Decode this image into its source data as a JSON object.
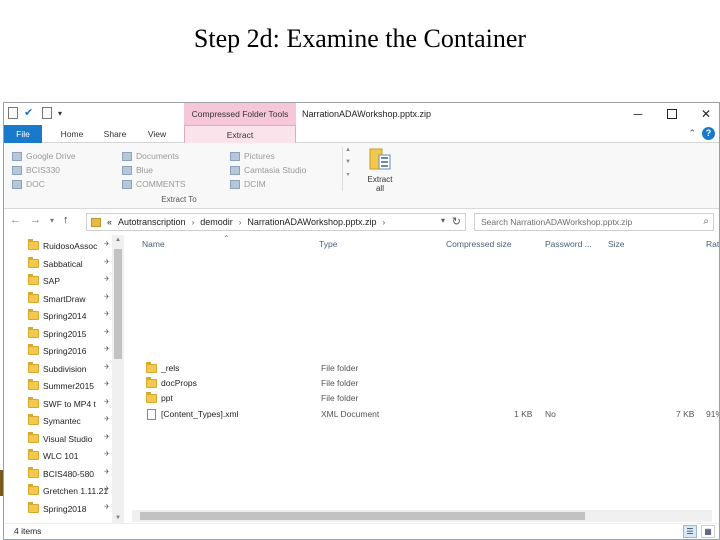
{
  "slide": {
    "title": "Step 2d: Examine the Container"
  },
  "window": {
    "title": "NarrationADAWorkshop.pptx.zip",
    "context_tab_title": "Compressed Folder Tools"
  },
  "ribbon": {
    "tabs": [
      {
        "label": "File"
      },
      {
        "label": "Home"
      },
      {
        "label": "Share"
      },
      {
        "label": "View"
      },
      {
        "label": "Extract"
      }
    ],
    "locations": [
      {
        "label": "Google Drive"
      },
      {
        "label": "BCIS330"
      },
      {
        "label": "DOC"
      },
      {
        "label": "Documents"
      },
      {
        "label": "Blue"
      },
      {
        "label": "COMMENTS"
      },
      {
        "label": "Pictures"
      },
      {
        "label": "Camtasia Studio"
      },
      {
        "label": "DCIM"
      }
    ],
    "group_label": "Extract To",
    "extract_all_line1": "Extract",
    "extract_all_line2": "all"
  },
  "address": {
    "overflow": "«",
    "crumbs": [
      "Autotranscription",
      "demodir",
      "NarrationADAWorkshop.pptx.zip"
    ],
    "search_placeholder": "Search NarrationADAWorkshop.pptx.zip"
  },
  "nav_pane": {
    "items": [
      {
        "label": "RuidosoAssoc"
      },
      {
        "label": "Sabbatical"
      },
      {
        "label": "SAP"
      },
      {
        "label": "SmartDraw"
      },
      {
        "label": "Spring2014"
      },
      {
        "label": "Spring2015"
      },
      {
        "label": "Spring2016"
      },
      {
        "label": "Subdivision"
      },
      {
        "label": "Summer2015"
      },
      {
        "label": "SWF to MP4 t"
      },
      {
        "label": "Symantec"
      },
      {
        "label": "Visual Studio"
      },
      {
        "label": "WLC 101"
      },
      {
        "label": "BCIS480-580"
      },
      {
        "label": "Gretchen 1.11.21"
      },
      {
        "label": "Spring2018"
      }
    ]
  },
  "file_list": {
    "columns": [
      "Name",
      "Type",
      "Compressed size",
      "Password ...",
      "Size",
      "Ratio"
    ],
    "rows": [
      {
        "name": "_rels",
        "type": "File folder",
        "compressed": "",
        "password": "",
        "size": "",
        "ratio": "",
        "icon": "folder-icon"
      },
      {
        "name": "docProps",
        "type": "File folder",
        "compressed": "",
        "password": "",
        "size": "",
        "ratio": "",
        "icon": "folder-icon"
      },
      {
        "name": "ppt",
        "type": "File folder",
        "compressed": "",
        "password": "",
        "size": "",
        "ratio": "",
        "icon": "folder-icon"
      },
      {
        "name": "[Content_Types].xml",
        "type": "XML Document",
        "compressed": "1 KB",
        "password": "No",
        "size": "7 KB",
        "ratio": "91%",
        "icon": "xml-document-icon"
      }
    ]
  },
  "status_bar": {
    "item_count": "4 items"
  },
  "colors": {
    "accent": "#1979ca",
    "context_tab": "#f5c7d9",
    "folder": "#f2c84e"
  }
}
